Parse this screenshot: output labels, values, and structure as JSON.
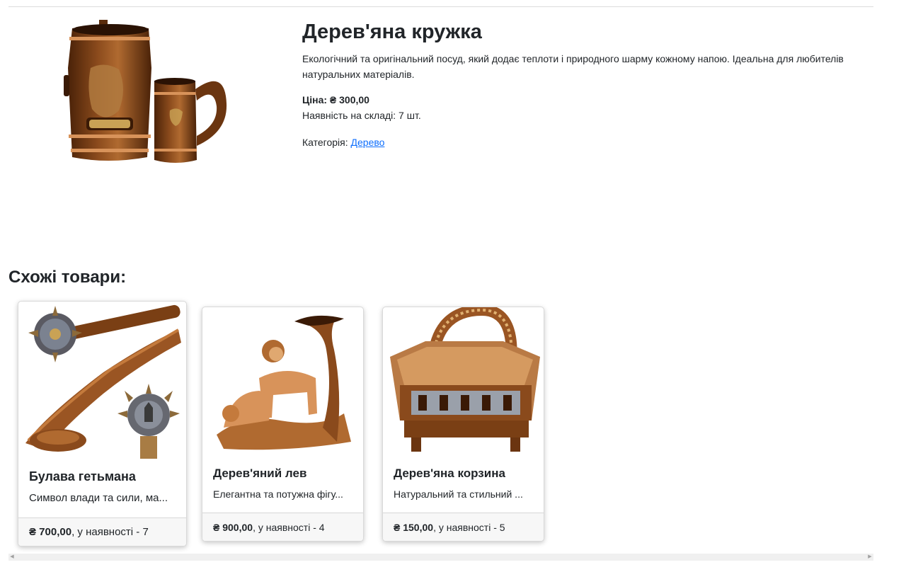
{
  "product": {
    "title": "Дерев'яна кружка",
    "description": "Екологічний та оригінальний посуд, який додає теплоти і природного шарму кожному напою. Ідеальна для любителів натуральних матеріалів.",
    "price_label": "Ціна: ₴ 300,00",
    "stock_label": "Наявність на складі: 7 шт.",
    "category_prefix": "Категорія: ",
    "category_link": "Дерево"
  },
  "similar": {
    "heading": "Схожі товари:",
    "items": [
      {
        "title": "Булава гетьмана",
        "description": "Символ влади та сили, ма...",
        "price": "₴ 700,00",
        "availability": ", у наявності - 7"
      },
      {
        "title": "Дерев'яний лев",
        "description": "Елегантна та потужна фігу...",
        "price": "₴ 900,00",
        "availability": ", у наявності - 4"
      },
      {
        "title": "Дерев'яна корзина",
        "description": "Натуральний та стильний ...",
        "price": "₴ 150,00",
        "availability": ", у наявності - 5"
      }
    ]
  },
  "colors": {
    "link": "#0d6efd",
    "text": "#212529",
    "wood_dark": "#6b3510",
    "wood_mid": "#9a5523",
    "wood_light": "#d8935a"
  },
  "icons": {
    "scroll_left": "scroll-left-arrow-icon",
    "scroll_right": "scroll-right-arrow-icon"
  }
}
